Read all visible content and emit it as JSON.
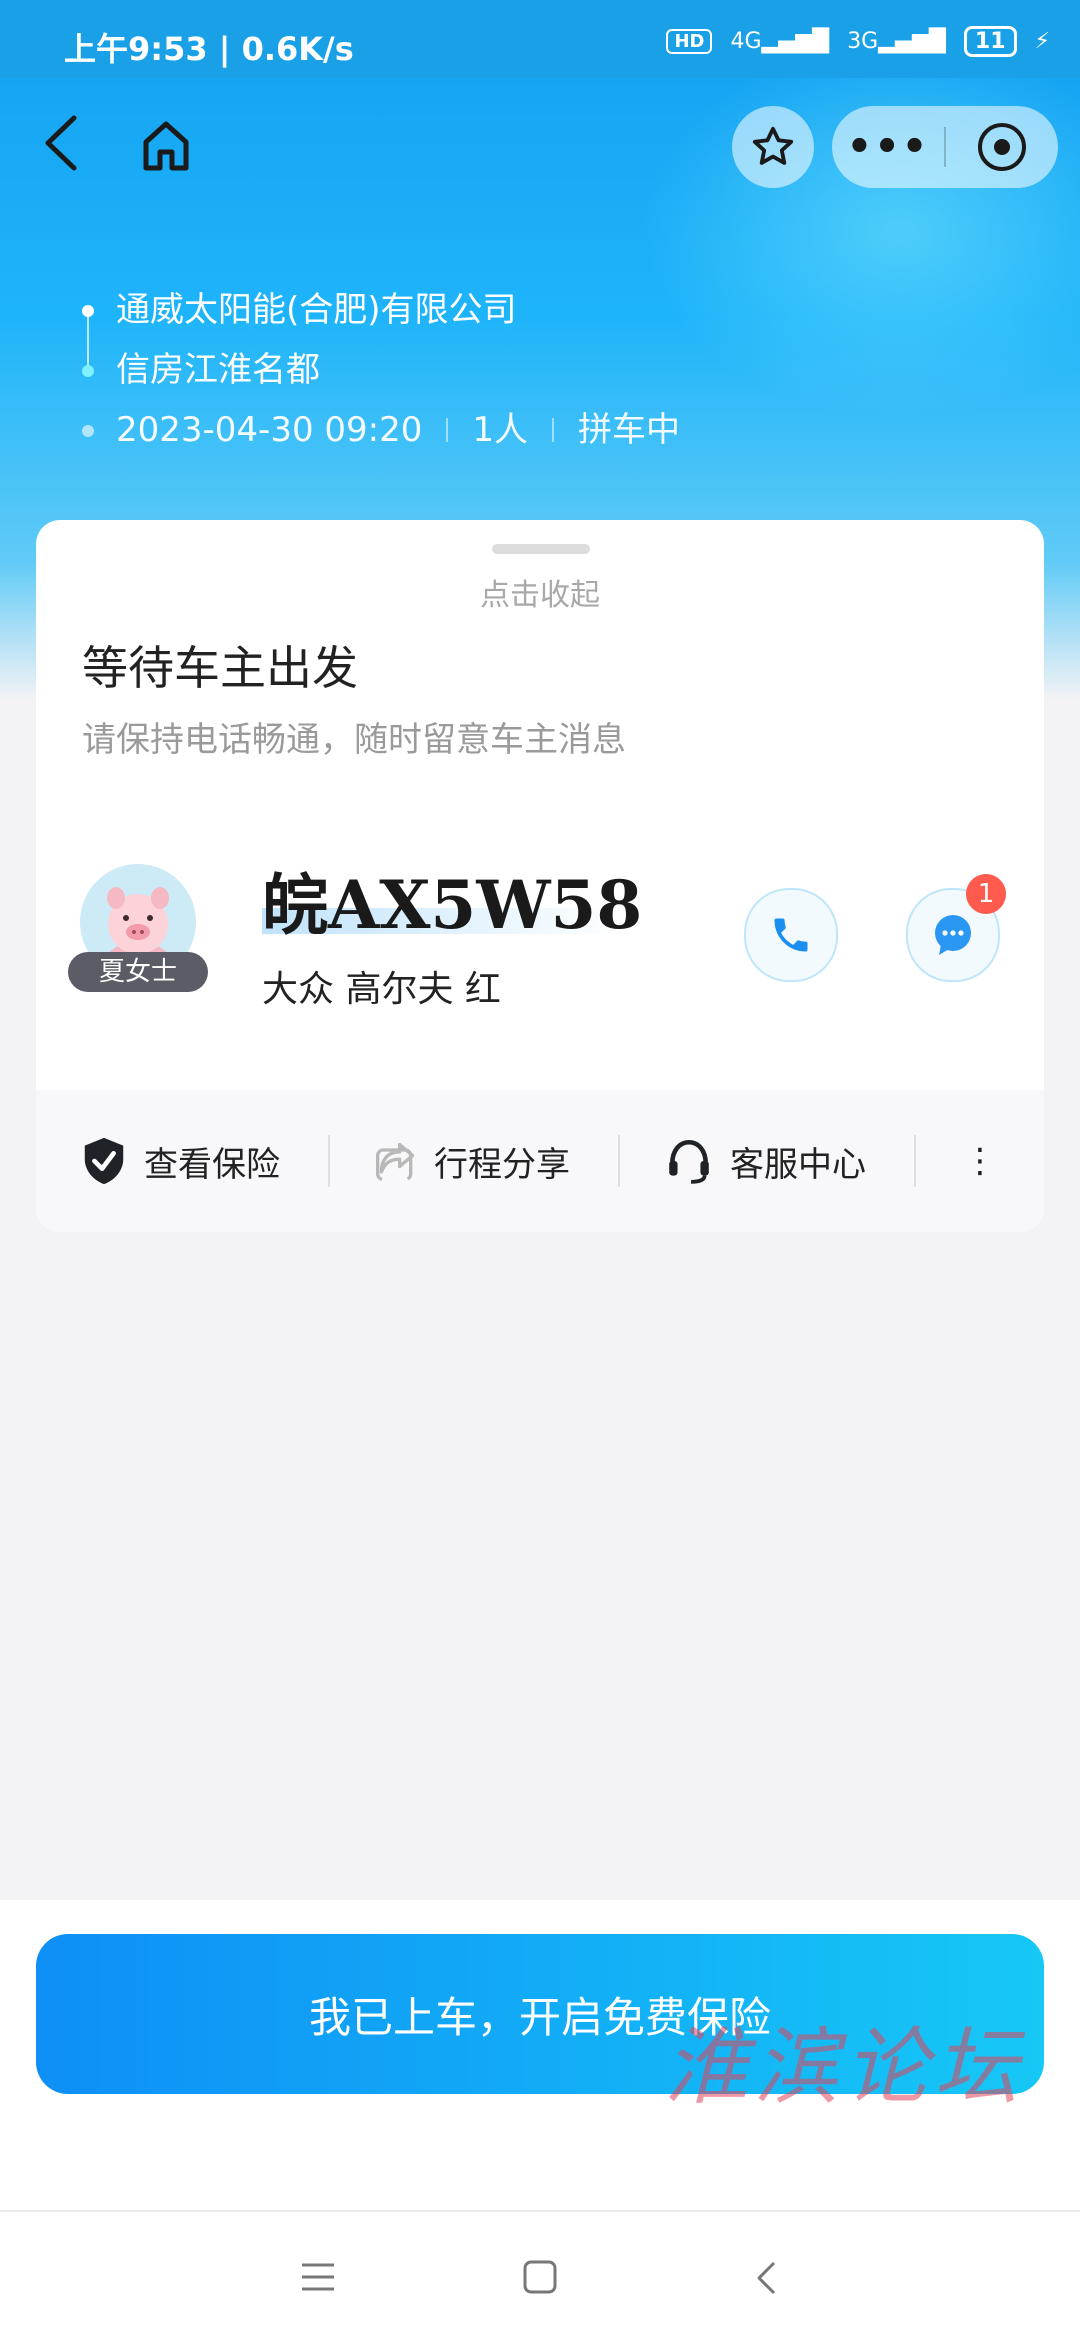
{
  "status_bar": {
    "time": "上午9:53 | 0.6K/s",
    "hd": "HD",
    "net1": "4G",
    "net2": "3G",
    "battery": "11"
  },
  "trip": {
    "from": "通威太阳能(合肥)有限公司",
    "to": "信房江淮名都",
    "datetime": "2023-04-30 09:20",
    "passengers": "1人",
    "status": "拼车中"
  },
  "card": {
    "collapse_label": "点击收起",
    "title": "等待车主出发",
    "subtitle": "请保持电话畅通，随时留意车主消息",
    "driver_name": "夏女士",
    "plate": "皖AX5W58",
    "car_desc": "大众 高尔夫 红",
    "chat_badge": "1"
  },
  "actions": [
    {
      "label": "查看保险",
      "icon": "shield-check-icon"
    },
    {
      "label": "行程分享",
      "icon": "share-icon"
    },
    {
      "label": "客服中心",
      "icon": "headset-icon"
    }
  ],
  "cta_label": "我已上车，开启免费保险",
  "watermark": "淮滨论坛",
  "colors": {
    "accent": "#14a0f0",
    "cta_start": "#0e8ff6",
    "cta_end": "#16c8f6",
    "badge": "#ff5a4e"
  }
}
